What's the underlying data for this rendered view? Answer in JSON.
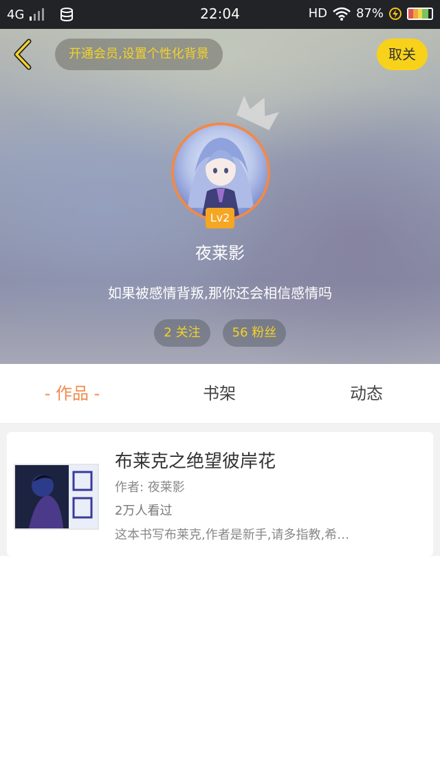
{
  "status_bar": {
    "network": "4G",
    "time": "22:04",
    "hd": "HD",
    "battery": "87%"
  },
  "header": {
    "vip_banner": "开通会员,设置个性化背景",
    "unfollow_label": "取关"
  },
  "profile": {
    "level": "Lv2",
    "username": "夜莱影",
    "bio": "如果被感情背叛,那你还会相信感情吗",
    "following": "2 关注",
    "followers": "56 粉丝"
  },
  "tabs": [
    {
      "label": "- 作品 -",
      "active": true
    },
    {
      "label": "书架",
      "active": false
    },
    {
      "label": "动态",
      "active": false
    }
  ],
  "books": [
    {
      "title": "布莱克之绝望彼岸花",
      "author": "作者: 夜莱影",
      "views": "2万人看过",
      "description": "这本书写布莱克,作者是新手,请多指教,希…"
    }
  ],
  "colors": {
    "accent_orange": "#f08a4a",
    "accent_yellow": "#f8d21a",
    "banner_text": "#f4d22a"
  }
}
